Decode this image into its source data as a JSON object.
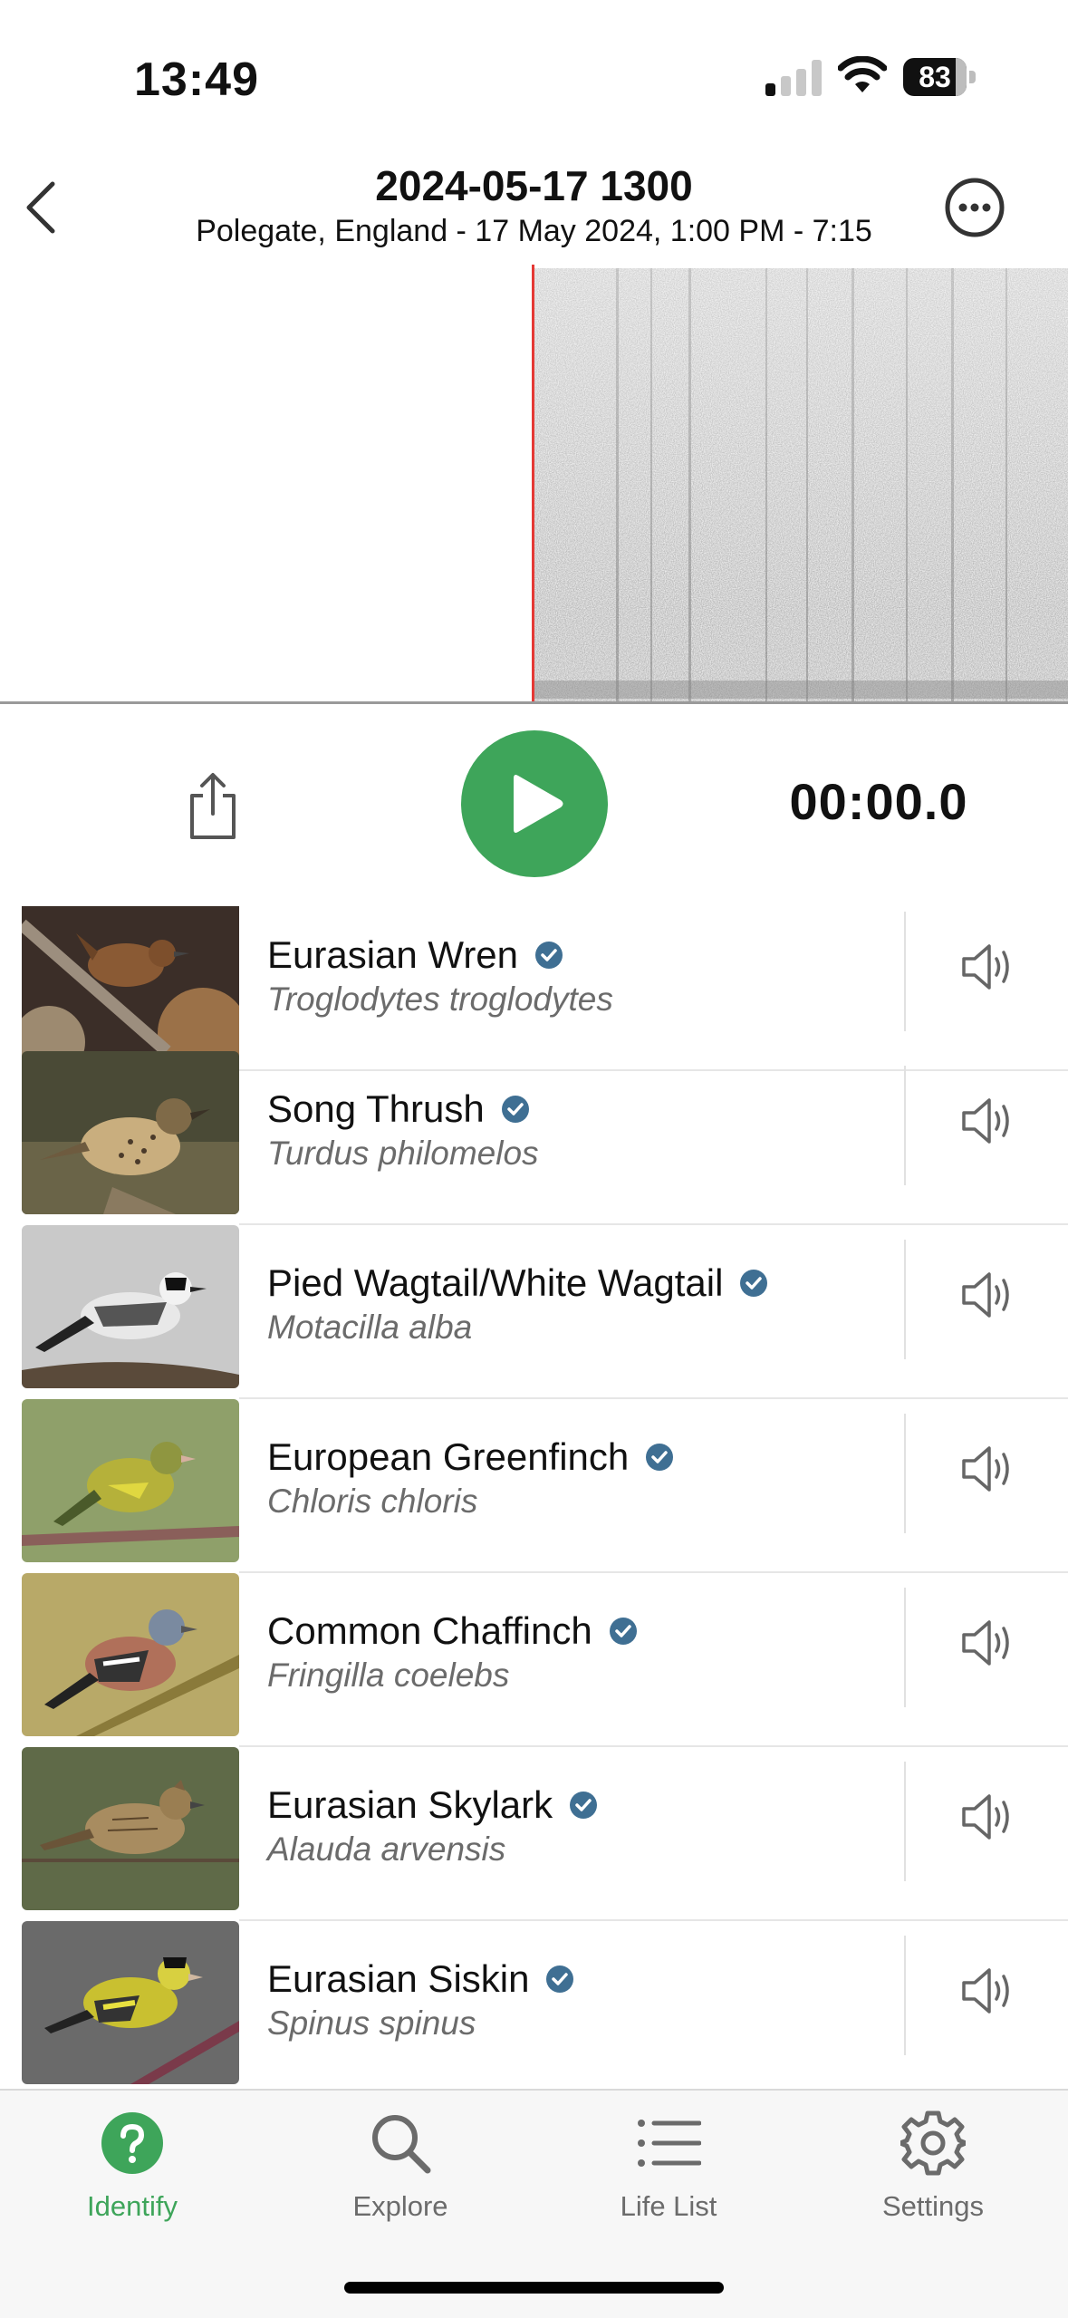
{
  "status_bar": {
    "time": "13:49",
    "battery": "83",
    "battery_fraction": 0.83
  },
  "header": {
    "title": "2024-05-17 1300",
    "subtitle": "Polegate, England - 17 May 2024, 1:00 PM - 7:15"
  },
  "player": {
    "time_readout": "00:00.0"
  },
  "colors": {
    "accent": "#3ea55a",
    "badge": "#3f6f93",
    "cursor": "#e53935"
  },
  "birds": [
    {
      "common": "Eurasian Wren",
      "scientific": "Troglodytes troglodytes",
      "verified": true
    },
    {
      "common": "Song Thrush",
      "scientific": "Turdus philomelos",
      "verified": true
    },
    {
      "common": "Pied Wagtail/White Wagtail",
      "scientific": "Motacilla alba",
      "verified": true
    },
    {
      "common": "European Greenfinch",
      "scientific": "Chloris chloris",
      "verified": true
    },
    {
      "common": "Common Chaffinch",
      "scientific": "Fringilla coelebs",
      "verified": true
    },
    {
      "common": "Eurasian Skylark",
      "scientific": "Alauda arvensis",
      "verified": true
    },
    {
      "common": "Eurasian Siskin",
      "scientific": "Spinus spinus",
      "verified": true
    }
  ],
  "tabs": [
    {
      "label": "Identify",
      "icon": "question-circle-icon",
      "active": true
    },
    {
      "label": "Explore",
      "icon": "search-icon",
      "active": false
    },
    {
      "label": "Life List",
      "icon": "list-icon",
      "active": false
    },
    {
      "label": "Settings",
      "icon": "gear-icon",
      "active": false
    }
  ]
}
